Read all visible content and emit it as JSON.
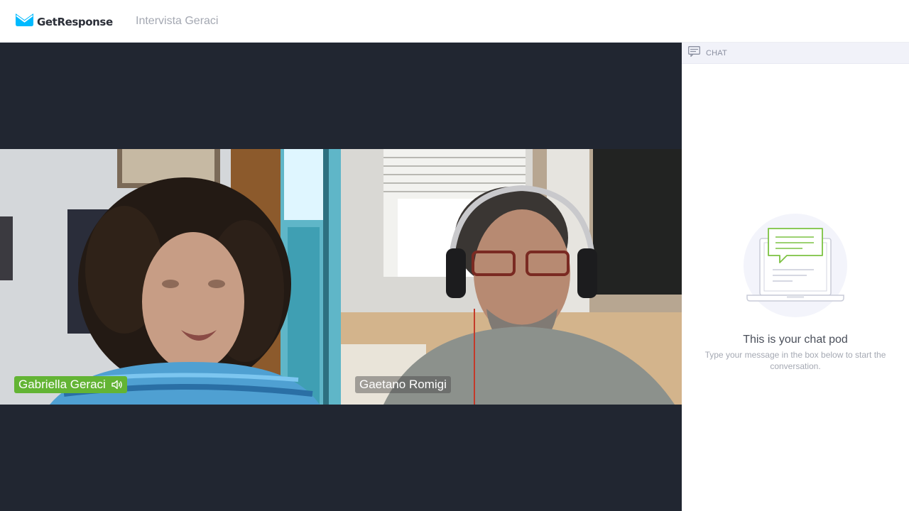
{
  "app": {
    "logo_text": "GetResponse",
    "meeting_title": "Intervista Geraci"
  },
  "participants": [
    {
      "name": "Gabriella Geraci",
      "speaking": true
    },
    {
      "name": "Gaetano Romigi",
      "speaking": false
    }
  ],
  "chat": {
    "header_label": "CHAT",
    "title": "This is your chat pod",
    "subtitle": "Type your message in the box below to start the conversation."
  },
  "colors": {
    "brand": "#00baff",
    "speaking": "#63b434",
    "stage": "#212631",
    "chat_accent": "#7cc242"
  }
}
